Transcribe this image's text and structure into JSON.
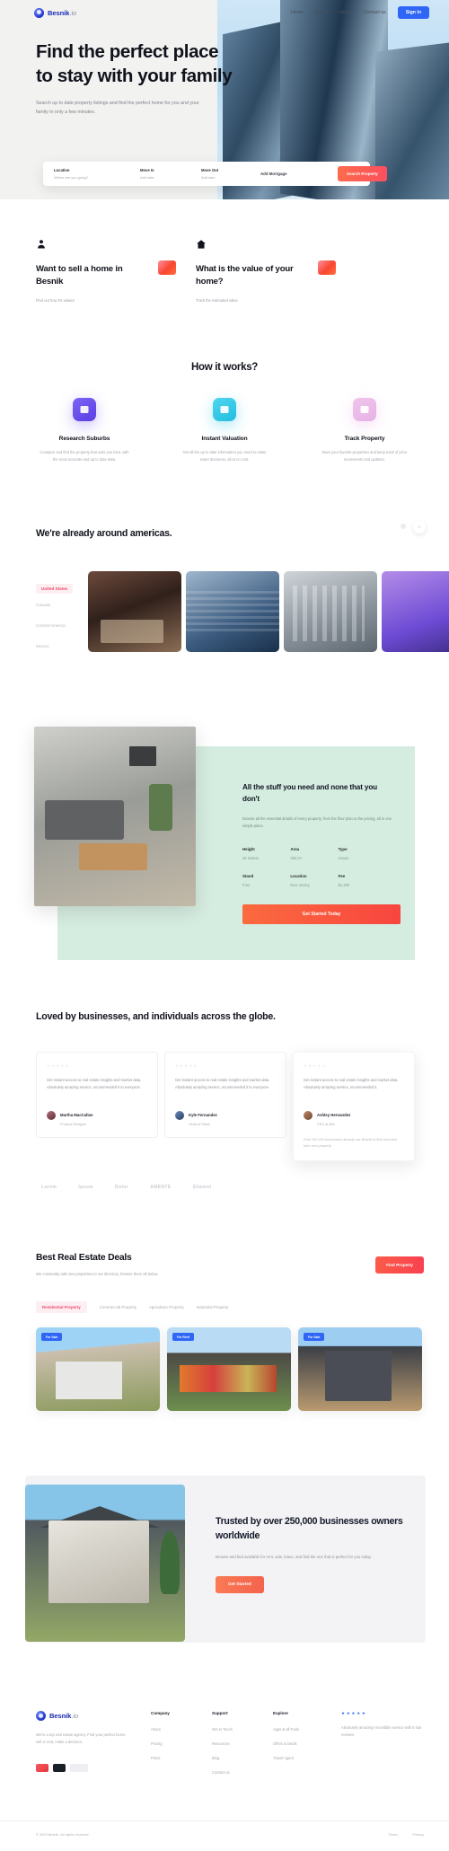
{
  "brand": {
    "name": "Besnik",
    "tld": ".io"
  },
  "nav": {
    "items": [
      {
        "label": "Home"
      },
      {
        "label": "Prices"
      },
      {
        "label": "About"
      },
      {
        "label": "Contact us"
      }
    ],
    "cta": "Sign in"
  },
  "hero": {
    "title": "Find the perfect place to stay with your family",
    "subtitle": "Search up to date property listings and find the perfect home for you and your family in only a few minutes."
  },
  "search": {
    "fields": [
      {
        "label": "Location",
        "value": "Where are you going?"
      },
      {
        "label": "Move In",
        "value": "Add date"
      },
      {
        "label": "Move Out",
        "value": "Add date"
      },
      {
        "label": "Add Mortgage",
        "value": ""
      }
    ],
    "button": "Search Property"
  },
  "promos": [
    {
      "icon": "person-icon",
      "title": "Want to sell a home in Besnik",
      "caption": "Find out how it's valued"
    },
    {
      "icon": "home-icon",
      "title": "What is the value of your home?",
      "caption": "Track the estimated value"
    }
  ],
  "how": {
    "title": "How it works?",
    "steps": [
      {
        "icon": "folder-icon",
        "title": "Research Suburbs",
        "text": "Compare and find the property that suits you best, with the most accurate and up to date data."
      },
      {
        "icon": "chart-icon",
        "title": "Instant Valuation",
        "text": "Get all the up to date information you need to make smart decisions, all at no cost."
      },
      {
        "icon": "pin-icon",
        "title": "Track Property",
        "text": "Save your favorite properties and keep track of price movements and updates."
      }
    ]
  },
  "americas": {
    "title": "We're already around americas.",
    "filters": [
      {
        "label": "United States",
        "active": true
      },
      {
        "label": "Canada",
        "active": false
      },
      {
        "label": "Central America",
        "active": false
      },
      {
        "label": "Mexico",
        "active": false
      }
    ],
    "cards": [
      {
        "name": "interior-living-room"
      },
      {
        "name": "blue-apartment-tower"
      },
      {
        "name": "grey-office-building"
      },
      {
        "name": "purple-modern-house"
      }
    ],
    "next_icon": "chevron-right-icon"
  },
  "stuff": {
    "title": "All the stuff you need and none that you don't",
    "text": "Browse all the essential details of every property, from the floor plan to the pricing, all in one simple place.",
    "specs": [
      {
        "key": "Height",
        "value": "20 meters"
      },
      {
        "key": "Area",
        "value": "250 m²"
      },
      {
        "key": "Type",
        "value": "House"
      },
      {
        "key": "Stand",
        "value": "Free"
      },
      {
        "key": "Location",
        "value": "New Jersey"
      },
      {
        "key": "Fee",
        "value": "$1,200"
      }
    ],
    "button": "Get Started Today",
    "image": "living-room-photo"
  },
  "loved": {
    "title": "Loved by businesses, and individuals across the globe.",
    "testimonials": [
      {
        "stars": "★★★★★",
        "quote": "Get instant access to real estate insights and market data. Absolutely amazing service, recommended it to everyone.",
        "name": "Martha MacCallan",
        "role": "Product Designer"
      },
      {
        "stars": "★★★★★",
        "quote": "Get instant access to real estate insights and market data. Absolutely amazing service, recommended it to everyone.",
        "name": "Kyle Fernandez",
        "role": "Head of Sales"
      },
      {
        "stars": "★★★★★",
        "quote": "Get instant access to real estate insights and market data. Absolutely amazing service, recommended it.",
        "name": "Ashley Hernandez",
        "role": "CEO at Brix",
        "note": "Over 250,000 businesses already use Besnik to find and track their next property."
      }
    ],
    "logos": [
      "Lorem",
      "Ipsum",
      "Dolor",
      "AMENTE",
      "Sitamet"
    ]
  },
  "deals": {
    "title": "Best Real Estate Deals",
    "subtitle": "We constantly add new properties to our directory, browse them all below.",
    "button": "Find Property",
    "tabs": [
      {
        "label": "Residential Property",
        "active": true
      },
      {
        "label": "Commercial Property",
        "active": false
      },
      {
        "label": "Agriculture Property",
        "active": false
      },
      {
        "label": "Industrial Property",
        "active": false
      }
    ],
    "cards": [
      {
        "badge": "For Sale",
        "image": "white-bungalow-house"
      },
      {
        "badge": "For Rent",
        "image": "modern-dark-roof-villa"
      },
      {
        "badge": "For Sale",
        "image": "grey-two-storey-house"
      }
    ]
  },
  "trusted": {
    "title": "Trusted by over 250,000 businesses owners worldwide",
    "text": "Browse and find available for rent, sale, lease, and find the one that is perfect for you today.",
    "button": "Get Started",
    "image": "suburban-family-house"
  },
  "footer": {
    "tagline": "We're a top real estate agency. Find your perfect home, sell or rent, make a decision.",
    "stores": [
      "app-store-badge",
      "google-play-badge"
    ],
    "columns": [
      {
        "title": "Company",
        "links": [
          "About",
          "Pricing",
          "Press"
        ]
      },
      {
        "title": "Support",
        "links": [
          "Get in Touch",
          "Resources",
          "Blog",
          "Contact us"
        ]
      },
      {
        "title": "Explore",
        "links": [
          "Apps & all Tools",
          "Offers & Deals",
          "Travel Agent"
        ]
      }
    ],
    "review": {
      "stars": "★★★★★",
      "text": "Absolutely amazing! Incredible service with 5 star reviews."
    },
    "copyright": "© 2023 Besnik. All rights reserved.",
    "legal": [
      "Terms",
      "Privacy"
    ]
  }
}
